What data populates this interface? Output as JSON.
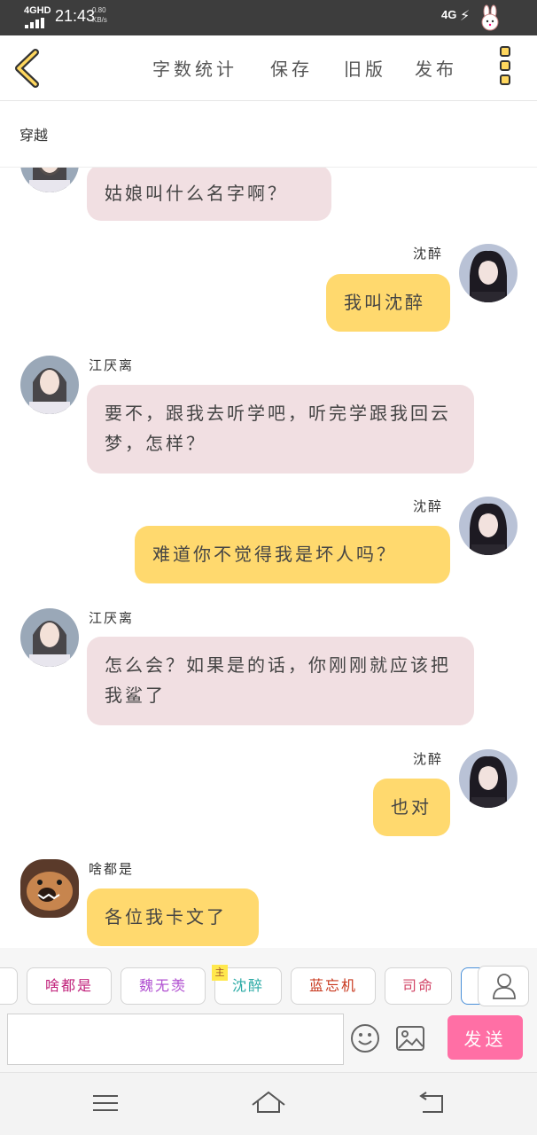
{
  "status_bar": {
    "network": "4GHD",
    "time": "21:43",
    "speed_value": "0.80",
    "speed_unit": "KB/s",
    "right_network": "4G"
  },
  "toolbar": {
    "items": [
      "字数统计",
      "保存",
      "旧版",
      "发布"
    ]
  },
  "scene": {
    "title": "穿越"
  },
  "messages": [
    {
      "side": "left",
      "sender": "",
      "text": "姑娘叫什么名字啊？"
    },
    {
      "side": "right",
      "sender": "沈醉",
      "text": "我叫沈醉"
    },
    {
      "side": "left",
      "sender": "江厌离",
      "text": "要不，跟我去听学吧，听完学跟我回云梦，怎样？"
    },
    {
      "side": "right",
      "sender": "沈醉",
      "text": "难道你不觉得我是坏人吗？"
    },
    {
      "side": "left",
      "sender": "江厌离",
      "text": "怎么会？如果是的话，你刚刚就应该把我鲨了"
    },
    {
      "side": "right",
      "sender": "沈醉",
      "text": "也对"
    },
    {
      "side": "left",
      "sender": "啥都是",
      "text": "各位我卡文了"
    }
  ],
  "characters": [
    {
      "name": "啥都是",
      "color": "#c0207a"
    },
    {
      "name": "魏无羡",
      "color": "#b04fd0"
    },
    {
      "name": "沈醉",
      "color": "#2aaaa5",
      "badge": "主"
    },
    {
      "name": "蓝忘机",
      "color": "#c8381e"
    },
    {
      "name": "司命",
      "color": "#d24466"
    }
  ],
  "input": {
    "value": "",
    "placeholder": ""
  },
  "send_label": "发送",
  "colors": {
    "pink_bubble": "#f1dfe2",
    "yellow_bubble": "#ffd96e",
    "send_button": "#ff6fa5",
    "accent_yellow": "#ffd75e"
  }
}
